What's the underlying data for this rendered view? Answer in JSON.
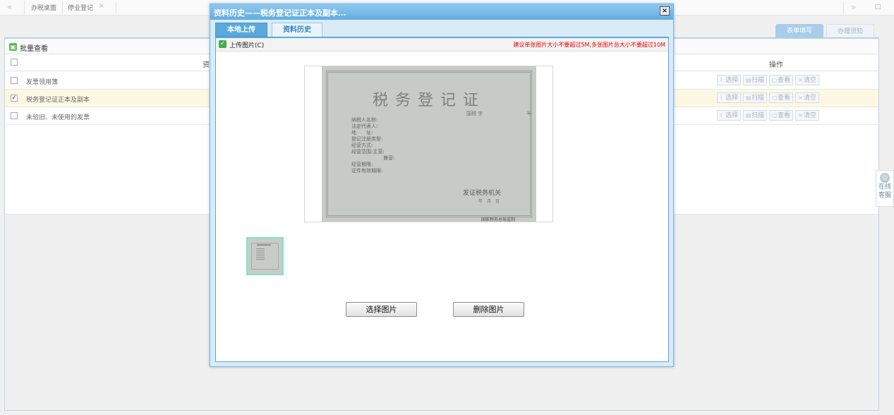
{
  "topbar": {
    "nav_prev": "«",
    "tabs": [
      {
        "label": "办税桌面"
      },
      {
        "label": "停业登记",
        "close": "×"
      }
    ],
    "nav_next": "»"
  },
  "right_tabs": [
    "表单填写",
    "办理须知"
  ],
  "batch": {
    "label": "批量查看"
  },
  "table": {
    "header_material": "资料",
    "header_ops": "操作",
    "rows": [
      {
        "label": "发票领用簿",
        "checked": false
      },
      {
        "label": "税务登记证正本及副本",
        "checked": true
      },
      {
        "label": "未验旧、未使用的发票",
        "checked": false
      }
    ],
    "ops": [
      "选择",
      "扫描",
      "查看",
      "清空"
    ]
  },
  "kefu": {
    "line1": "在线",
    "line2": "客服"
  },
  "dialog": {
    "title": "资料历史——税务登记证正本及副本...",
    "close": "×",
    "tabs": [
      "本地上传",
      "资料历史"
    ],
    "upload_label": "上传图片(C)",
    "upload_note": "建议单张图片大小不要超过5M,多张图片总大小不要超过10M",
    "buttons": {
      "choose": "选择图片",
      "delete": "删除图片"
    },
    "certificate": {
      "title": "税务登记证",
      "number_prefix": "国税 字",
      "number_suffix": "号",
      "fields": [
        "纳税人名称:",
        "法定代表人:",
        "地　　址:",
        "登记注册类型:",
        "经营方式:",
        "经营范围:主营:",
        "兼营:",
        "经营期限:",
        "证件有效期限:"
      ],
      "issuer": "发证税务机关",
      "date": "年　月　日",
      "printer": "国家税务总局监制"
    }
  }
}
